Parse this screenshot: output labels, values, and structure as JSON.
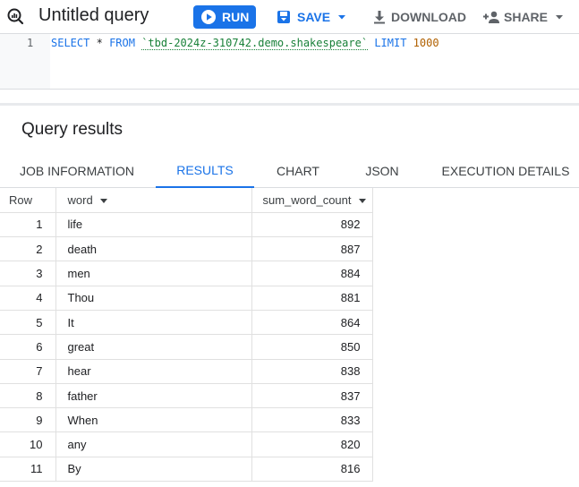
{
  "toolbar": {
    "title": "Untitled query",
    "run_label": "RUN",
    "save_label": "SAVE",
    "download_label": "DOWNLOAD",
    "share_label": "SHARE"
  },
  "editor": {
    "line_number": "1",
    "kw_select": "SELECT",
    "star": "*",
    "kw_from": "FROM",
    "table_ref": "`tbd-2024z-310742.demo.shakespeare`",
    "kw_limit": "LIMIT",
    "limit_value": "1000"
  },
  "results": {
    "title": "Query results",
    "tabs": [
      {
        "label": "JOB INFORMATION",
        "active": false
      },
      {
        "label": "RESULTS",
        "active": true
      },
      {
        "label": "CHART",
        "active": false
      },
      {
        "label": "JSON",
        "active": false
      },
      {
        "label": "EXECUTION DETAILS",
        "active": false
      }
    ],
    "columns": [
      "Row",
      "word",
      "sum_word_count"
    ],
    "rows": [
      {
        "row": "1",
        "word": "life",
        "count": "892"
      },
      {
        "row": "2",
        "word": "death",
        "count": "887"
      },
      {
        "row": "3",
        "word": "men",
        "count": "884"
      },
      {
        "row": "4",
        "word": "Thou",
        "count": "881"
      },
      {
        "row": "5",
        "word": "It",
        "count": "864"
      },
      {
        "row": "6",
        "word": "great",
        "count": "850"
      },
      {
        "row": "7",
        "word": "hear",
        "count": "838"
      },
      {
        "row": "8",
        "word": "father",
        "count": "837"
      },
      {
        "row": "9",
        "word": "When",
        "count": "833"
      },
      {
        "row": "10",
        "word": "any",
        "count": "820"
      },
      {
        "row": "11",
        "word": "By",
        "count": "816"
      }
    ]
  },
  "colors": {
    "accent": "#1a73e8",
    "keyword": "#1a73e8",
    "table_ref": "#188038",
    "number": "#b06000"
  },
  "icons": [
    "query-icon",
    "play-icon",
    "save-icon",
    "chevron-down-icon",
    "download-icon",
    "person-add-icon",
    "sort-caret-icon"
  ]
}
